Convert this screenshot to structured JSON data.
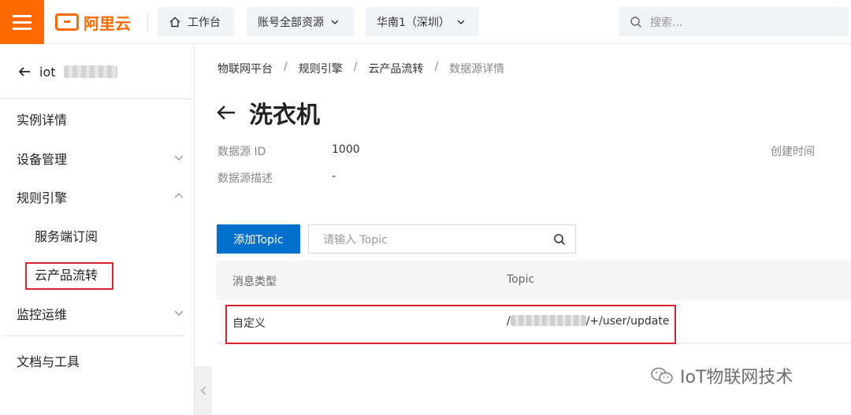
{
  "topbar": {
    "logo_text": "阿里云",
    "home_label": "工作台",
    "resources_label": "账号全部资源",
    "region_label": "华南1（深圳）",
    "search_placeholder": "搜索..."
  },
  "sidebar": {
    "instance_name": "iot",
    "items": [
      {
        "label": "实例详情"
      },
      {
        "label": "设备管理"
      },
      {
        "label": "规则引擎"
      },
      {
        "label": "服务端订阅"
      },
      {
        "label": "云产品流转"
      },
      {
        "label": "监控运维"
      },
      {
        "label": "文档与工具"
      }
    ]
  },
  "breadcrumb": [
    "物联网平台",
    "规则引擎",
    "云产品流转",
    "数据源详情"
  ],
  "breadcrumb_sep": "/",
  "page": {
    "title": "洗衣机",
    "info": {
      "id_label": "数据源 ID",
      "id_value": "1000",
      "desc_label": "数据源描述",
      "desc_value": "-",
      "created_label": "创建时间"
    }
  },
  "topics": {
    "add_button": "添加Topic",
    "search_placeholder": "请输入 Topic",
    "columns": [
      "消息类型",
      "Topic"
    ],
    "rows": [
      {
        "type": "自定义",
        "topic_prefix": "/",
        "topic_suffix": "/+/user/update"
      }
    ]
  },
  "watermark": "IoT物联网技术",
  "colors": {
    "accent": "#ff6a00",
    "primary": "#0070cc",
    "highlight": "#d9232e"
  }
}
